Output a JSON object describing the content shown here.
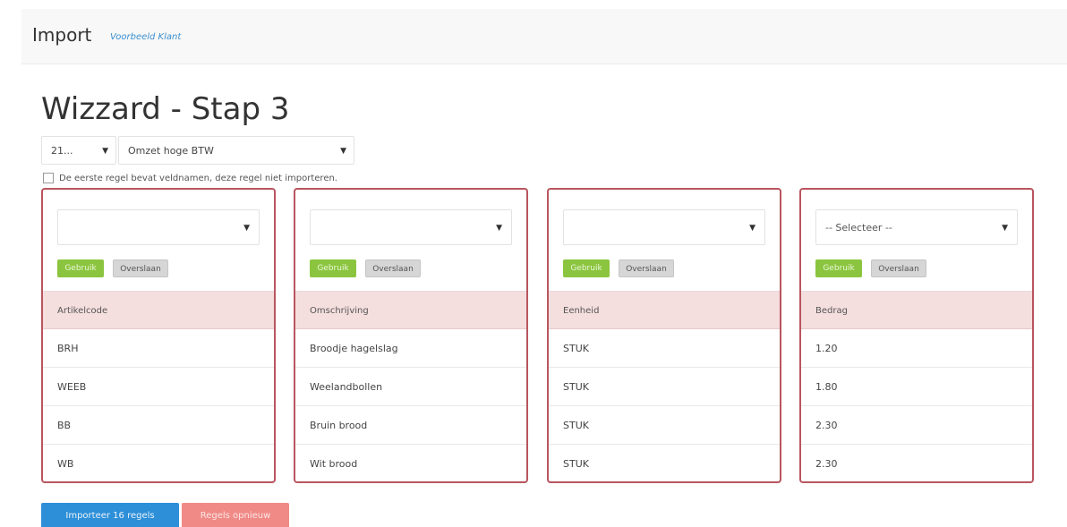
{
  "header": {
    "title": "Import",
    "subtitle": "Voorbeeld Klant"
  },
  "page": {
    "heading": "Wizzard - Stap 3"
  },
  "filters": {
    "year_value": "21...",
    "btw_value": "Omzet hoge BTW"
  },
  "checkbox": {
    "label": "De eerste regel bevat veldnamen, deze regel niet importeren."
  },
  "columns": [
    {
      "select_value": "",
      "use_label": "Gebruik",
      "skip_label": "Overslaan",
      "header": "Artikelcode",
      "rows": [
        "BRH",
        "WEEB",
        "BB",
        "WB"
      ]
    },
    {
      "select_value": "",
      "use_label": "Gebruik",
      "skip_label": "Overslaan",
      "header": "Omschrijving",
      "rows": [
        "Broodje hagelslag",
        "Weelandbollen",
        "Bruin brood",
        "Wit brood"
      ]
    },
    {
      "select_value": "",
      "use_label": "Gebruik",
      "skip_label": "Overslaan",
      "header": "Eenheid",
      "rows": [
        "STUK",
        "STUK",
        "STUK",
        "STUK"
      ]
    },
    {
      "select_value": "-- Selecteer --",
      "use_label": "Gebruik",
      "skip_label": "Overslaan",
      "header": "Bedrag",
      "rows": [
        "1.20",
        "1.80",
        "2.30",
        "2.30"
      ]
    }
  ],
  "actions": {
    "import_label": "Importeer 16 regels",
    "reset_label": "Regels opnieuw"
  },
  "icons": {
    "caret": "caret-down-icon"
  },
  "colors": {
    "column_border": "#b9555f",
    "header_row": "#f5dede",
    "use_button": "#8bc53f",
    "import_button": "#2d8fd8",
    "reset_button": "#ef8a86"
  }
}
